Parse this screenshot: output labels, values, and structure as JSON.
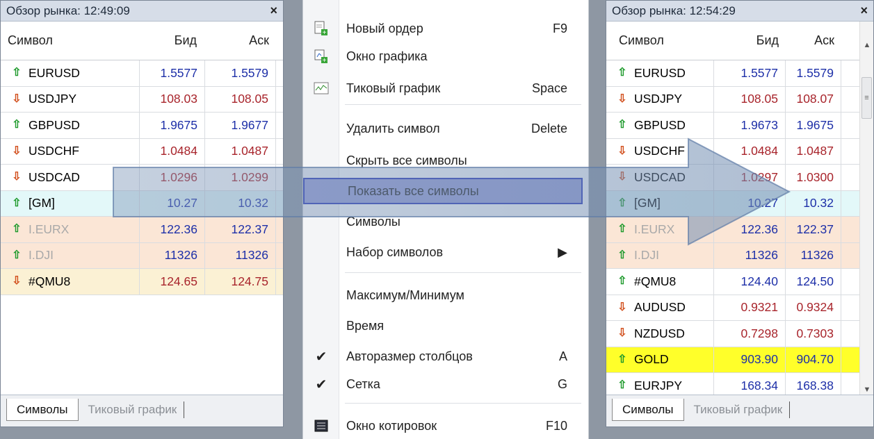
{
  "left_panel": {
    "title": "Обзор рынка: 12:49:09",
    "close_label": "×",
    "headers": {
      "symbol": "Символ",
      "bid": "Бид",
      "ask": "Аск"
    },
    "rows": [
      {
        "symbol": "EURUSD",
        "bid": "1.5577",
        "ask": "1.5579",
        "dir": "up"
      },
      {
        "symbol": "USDJPY",
        "bid": "108.03",
        "ask": "108.05",
        "dir": "down"
      },
      {
        "symbol": "GBPUSD",
        "bid": "1.9675",
        "ask": "1.9677",
        "dir": "up"
      },
      {
        "symbol": "USDCHF",
        "bid": "1.0484",
        "ask": "1.0487",
        "dir": "down"
      },
      {
        "symbol": "USDCAD",
        "bid": "1.0296",
        "ask": "1.0299",
        "dir": "down"
      },
      {
        "symbol": "[GM]",
        "bid": "10.27",
        "ask": "10.32",
        "dir": "up"
      },
      {
        "symbol": "I.EURX",
        "bid": "122.36",
        "ask": "122.37",
        "dir": "up"
      },
      {
        "symbol": "I.DJI",
        "bid": "11326",
        "ask": "11326",
        "dir": "up"
      },
      {
        "symbol": "#QMU8",
        "bid": "124.65",
        "ask": "124.75",
        "dir": "down"
      }
    ],
    "tabs": [
      "Символы",
      "Тиковый график"
    ]
  },
  "menu": {
    "items": [
      {
        "label": "Новый ордер",
        "key": "F9",
        "icon": "new-order-icon"
      },
      {
        "label": "Окно графика",
        "key": "",
        "icon": "chart-window-icon"
      },
      {
        "label": "Тиковый график",
        "key": "Space",
        "icon": "tick-chart-icon"
      },
      {
        "label": "Удалить символ",
        "key": "Delete",
        "icon": ""
      },
      {
        "label": "Скрыть все символы",
        "key": "",
        "icon": ""
      },
      {
        "label": "Показать все символы",
        "key": "",
        "icon": ""
      },
      {
        "label": "Символы",
        "key": "",
        "icon": ""
      },
      {
        "label": "Набор символов",
        "key": "▶",
        "icon": ""
      },
      {
        "label": "Максимум/Минимум",
        "key": "",
        "icon": ""
      },
      {
        "label": "Время",
        "key": "",
        "icon": ""
      },
      {
        "label": "Авторазмер столбцов",
        "key": "A",
        "icon": "check-icon"
      },
      {
        "label": "Сетка",
        "key": "G",
        "icon": "check-icon"
      },
      {
        "label": "Окно котировок",
        "key": "F10",
        "icon": "quotes-window-icon"
      }
    ]
  },
  "right_panel": {
    "title": "Обзор рынка: 12:54:29",
    "close_label": "×",
    "headers": {
      "symbol": "Символ",
      "bid": "Бид",
      "ask": "Аск"
    },
    "rows": [
      {
        "symbol": "EURUSD",
        "bid": "1.5577",
        "ask": "1.5579",
        "dir": "up"
      },
      {
        "symbol": "USDJPY",
        "bid": "108.05",
        "ask": "108.07",
        "dir": "down"
      },
      {
        "symbol": "GBPUSD",
        "bid": "1.9673",
        "ask": "1.9675",
        "dir": "up"
      },
      {
        "symbol": "USDCHF",
        "bid": "1.0484",
        "ask": "1.0487",
        "dir": "down"
      },
      {
        "symbol": "USDCAD",
        "bid": "1.0297",
        "ask": "1.0300",
        "dir": "down"
      },
      {
        "symbol": "[GM]",
        "bid": "10.27",
        "ask": "10.32",
        "dir": "up"
      },
      {
        "symbol": "I.EURX",
        "bid": "122.36",
        "ask": "122.37",
        "dir": "up"
      },
      {
        "symbol": "I.DJI",
        "bid": "11326",
        "ask": "11326",
        "dir": "up"
      },
      {
        "symbol": "#QMU8",
        "bid": "124.40",
        "ask": "124.50",
        "dir": "up"
      },
      {
        "symbol": "AUDUSD",
        "bid": "0.9321",
        "ask": "0.9324",
        "dir": "down"
      },
      {
        "symbol": "NZDUSD",
        "bid": "0.7298",
        "ask": "0.7303",
        "dir": "down"
      },
      {
        "symbol": "GOLD",
        "bid": "903.90",
        "ask": "904.70",
        "dir": "up"
      },
      {
        "symbol": "EURJPY",
        "bid": "168.34",
        "ask": "168.38",
        "dir": "up"
      }
    ],
    "tabs": [
      "Символы",
      "Тиковый график"
    ]
  },
  "colors": {
    "highlight": "#9aa0d8",
    "up": "#1e9a2c",
    "down": "#d2501e"
  }
}
